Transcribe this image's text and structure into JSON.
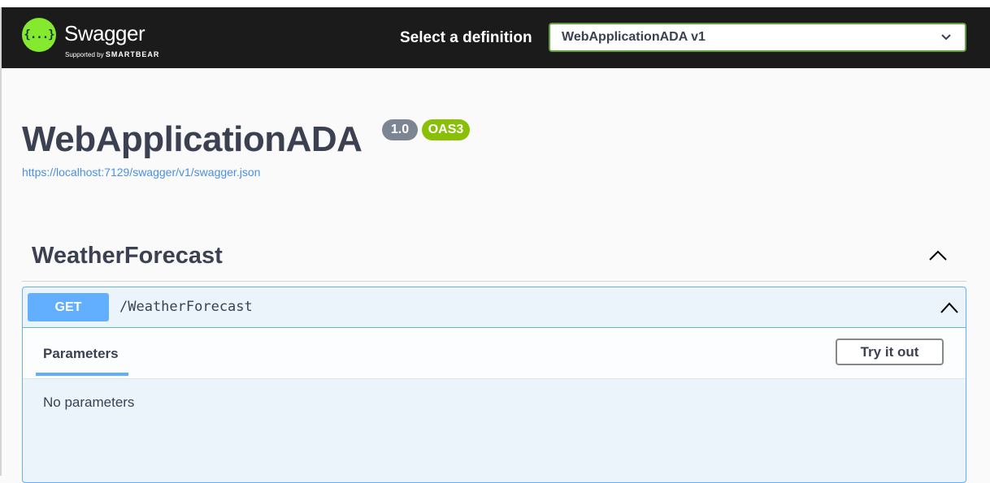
{
  "topbar": {
    "logo_name": "Swagger",
    "logo_sub_prefix": "Supported by",
    "logo_sub_brand": "SMARTBEAR",
    "logo_glyph": "{...}",
    "definition_label": "Select a definition",
    "definition_value": "WebApplicationADA v1"
  },
  "info": {
    "title": "WebApplicationADA",
    "version_badge": "1.0",
    "oas_badge": "OAS3",
    "spec_url": "https://localhost:7129/swagger/v1/swagger.json"
  },
  "tag": {
    "name": "WeatherForecast"
  },
  "operation": {
    "method": "GET",
    "path": "/WeatherForecast",
    "parameters_tab": "Parameters",
    "try_button": "Try it out",
    "no_params_text": "No parameters"
  },
  "colors": {
    "topbar_bg": "#1b1b1b",
    "logo_green": "#85ea2d",
    "get_blue": "#61affe",
    "oas_green": "#89bf04",
    "version_gray": "#7d8492"
  }
}
